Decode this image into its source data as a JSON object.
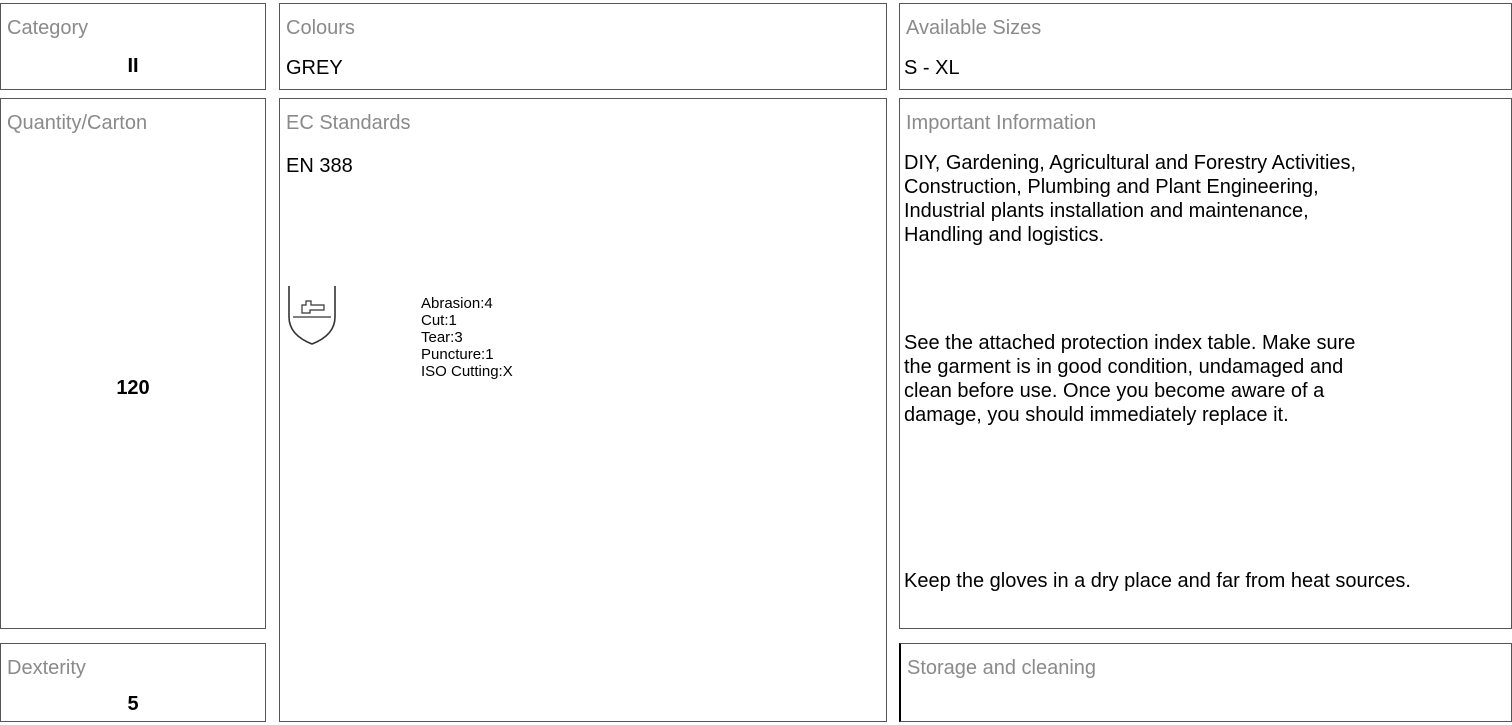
{
  "category": {
    "label": "Category",
    "value": "II"
  },
  "colours": {
    "label": "Colours",
    "value": "GREY"
  },
  "sizes": {
    "label": "Available Sizes",
    "value": "S - XL"
  },
  "quantity": {
    "label": "Quantity/Carton",
    "value": "120"
  },
  "dexterity": {
    "label": "Dexterity",
    "value": "5"
  },
  "ec": {
    "label": "EC Standards",
    "standard": "EN 388",
    "icon": "en388-hand-shield-icon",
    "ratings": [
      "Abrasion:4",
      "Cut:1",
      "Tear:3",
      "Puncture:1",
      "ISO Cutting:X"
    ]
  },
  "important": {
    "label": "Important Information",
    "paragraphs": [
      "DIY, Gardening, Agricultural and Forestry Activities, Construction, Plumbing and Plant Engineering, Industrial plants installation and maintenance, Handling and logistics.",
      "See the attached protection index table. Make sure the garment is in good condition, undamaged and clean before use. Once you become aware of a damage, you should immediately replace it.",
      "Keep the gloves in a dry place and far from heat sources."
    ]
  },
  "storage": {
    "label": "Storage and cleaning"
  }
}
